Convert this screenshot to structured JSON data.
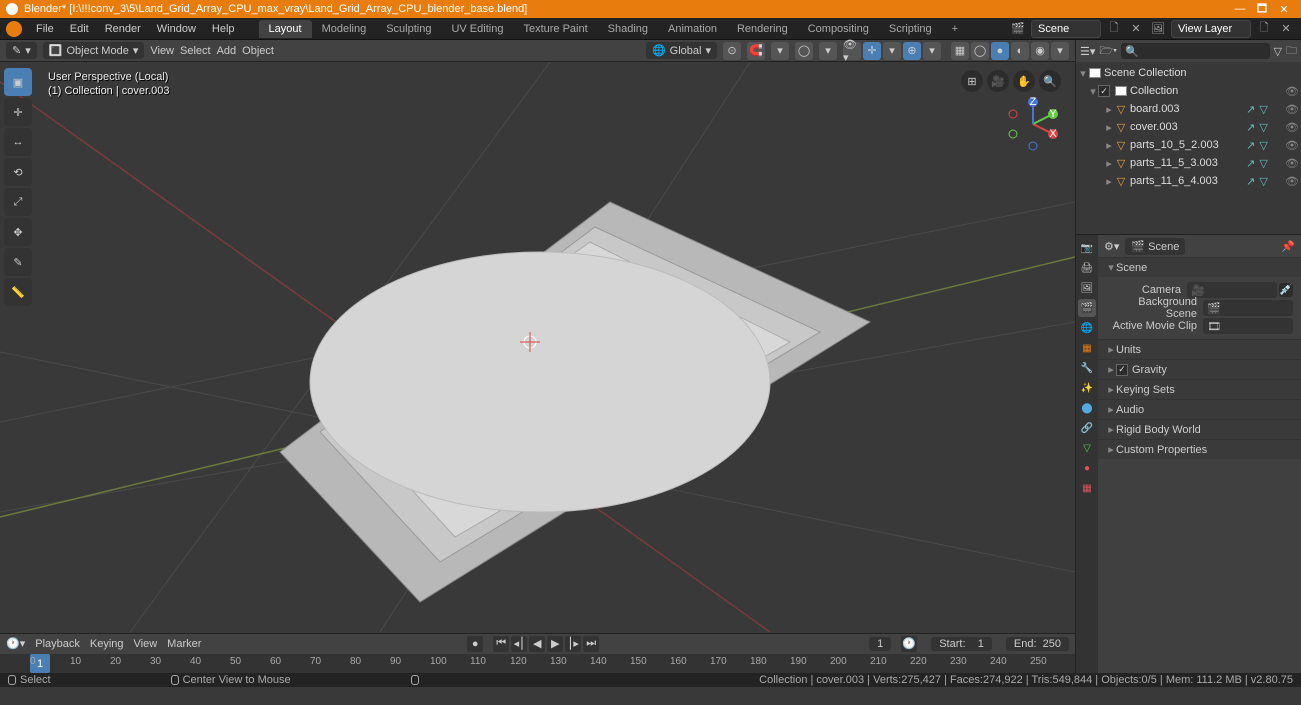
{
  "app": {
    "name": "Blender",
    "file_path": "[I:\\!!!conv_3\\5\\Land_Grid_Array_CPU_max_vray\\Land_Grid_Array_CPU_blender_base.blend]"
  },
  "window_controls": {
    "min": "—",
    "max": "🗖",
    "close": "✕"
  },
  "topmenu": {
    "items": [
      "File",
      "Edit",
      "Render",
      "Window",
      "Help"
    ],
    "tabs": [
      "Layout",
      "Modeling",
      "Sculpting",
      "UV Editing",
      "Texture Paint",
      "Shading",
      "Animation",
      "Rendering",
      "Compositing",
      "Scripting"
    ],
    "active_tab": "Layout",
    "add_tab": "+",
    "scene_label": "Scene",
    "viewlayer_label": "View Layer"
  },
  "viewport": {
    "mode": "Object Mode",
    "menus": [
      "View",
      "Select",
      "Add",
      "Object"
    ],
    "orientation": "Global",
    "overlay_persp": "User Perspective (Local)",
    "overlay_coll": "(1) Collection | cover.003",
    "tools": [
      "select-box",
      "cursor",
      "move",
      "rotate",
      "scale",
      "transform",
      "annotate",
      "measure"
    ]
  },
  "outliner": {
    "search_placeholder": "",
    "root": "Scene Collection",
    "collection": "Collection",
    "items": [
      {
        "name": "board.003"
      },
      {
        "name": "cover.003"
      },
      {
        "name": "parts_10_5_2.003"
      },
      {
        "name": "parts_11_5_3.003"
      },
      {
        "name": "parts_11_6_4.003"
      }
    ]
  },
  "properties": {
    "crumb_icon": "🎬",
    "crumb": "Scene",
    "section_scene": "Scene",
    "camera_label": "Camera",
    "camera_val": "",
    "bgscene_label": "Background Scene",
    "bgscene_val": "",
    "clip_label": "Active Movie Clip",
    "clip_val": "",
    "sections": [
      "Units",
      "Gravity",
      "Keying Sets",
      "Audio",
      "Rigid Body World",
      "Custom Properties"
    ],
    "tabs": [
      "render",
      "output",
      "viewlayer",
      "scene",
      "world",
      "object",
      "modifier",
      "particle",
      "physics",
      "constraint",
      "data",
      "material",
      "texture"
    ]
  },
  "timeline": {
    "menus": [
      "Playback",
      "Keying",
      "View",
      "Marker"
    ],
    "dropdown_icon": "▾",
    "current": "1",
    "start_label": "Start:",
    "start_val": "1",
    "end_label": "End:",
    "end_val": "250",
    "ticks": [
      "0",
      "10",
      "20",
      "30",
      "40",
      "50",
      "60",
      "70",
      "80",
      "90",
      "100",
      "110",
      "120",
      "130",
      "140",
      "150",
      "160",
      "170",
      "180",
      "190",
      "200",
      "210",
      "220",
      "230",
      "240",
      "250"
    ]
  },
  "statusbar": {
    "left1": "Select",
    "left2": "Center View to Mouse",
    "right": "Collection | cover.003 | Verts:275,427 | Faces:274,922 | Tris:549,844 | Objects:0/5 | Mem: 111.2 MB | v2.80.75"
  },
  "icons": {
    "chevron_down": "▾",
    "chevron_right": "▸",
    "search": "🔍",
    "filter": "⚙",
    "grid": "⊞",
    "camera": "🎥",
    "hand": "✋",
    "zoom": "🔍",
    "eye": "👁"
  }
}
